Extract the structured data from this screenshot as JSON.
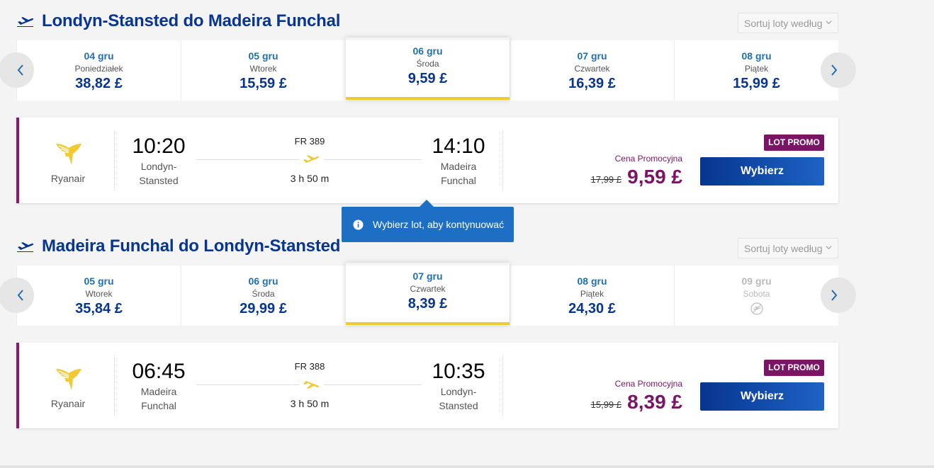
{
  "outbound": {
    "title": "Londyn-Stansted do Madeira Funchal",
    "sort_label": "Sortuj loty według",
    "dates": [
      {
        "date": "04 gru",
        "weekday": "Poniedziałek",
        "price": "38,82 £"
      },
      {
        "date": "05 gru",
        "weekday": "Wtorek",
        "price": "15,59 £"
      },
      {
        "date": "06 gru",
        "weekday": "Środa",
        "price": "9,59 £"
      },
      {
        "date": "07 gru",
        "weekday": "Czwartek",
        "price": "16,39 £"
      },
      {
        "date": "08 gru",
        "weekday": "Piątek",
        "price": "15,99 £"
      }
    ],
    "selected_index": 2,
    "flight": {
      "airline": "Ryanair",
      "depart_time": "10:20",
      "depart_place": "Londyn-\nStansted",
      "flight_number": "FR 389",
      "duration": "3 h 50 m",
      "arrive_time": "14:10",
      "arrive_place": "Madeira\nFunchal",
      "badge": "LOT PROMO",
      "promo_label": "Cena Promocyjna",
      "old_price": "17,99 £",
      "price": "9,59 £",
      "button": "Wybierz"
    }
  },
  "tooltip": {
    "text": "Wybierz lot, aby kontynuować"
  },
  "inbound": {
    "title": "Madeira Funchal do Londyn-Stansted",
    "sort_label": "Sortuj loty według",
    "dates": [
      {
        "date": "05 gru",
        "weekday": "Wtorek",
        "price": "35,84 £"
      },
      {
        "date": "06 gru",
        "weekday": "Środa",
        "price": "29,99 £"
      },
      {
        "date": "07 gru",
        "weekday": "Czwartek",
        "price": "8,39 £"
      },
      {
        "date": "08 gru",
        "weekday": "Piątek",
        "price": "24,30 £"
      },
      {
        "date": "09 gru",
        "weekday": "Sobota",
        "price": ""
      }
    ],
    "selected_index": 2,
    "flight": {
      "airline": "Ryanair",
      "depart_time": "06:45",
      "depart_place": "Madeira\nFunchal",
      "flight_number": "FR 388",
      "duration": "3 h 50 m",
      "arrive_time": "10:35",
      "arrive_place": "Londyn-\nStansted",
      "badge": "LOT PROMO",
      "promo_label": "Cena Promocyjna",
      "old_price": "15,99 £",
      "price": "8,39 £",
      "button": "Wybierz"
    }
  },
  "colors": {
    "brand_blue": "#073590",
    "accent_purple": "#7a1464",
    "selected_bar": "#f1c933",
    "ryanair_yellow": "#f1c933"
  }
}
